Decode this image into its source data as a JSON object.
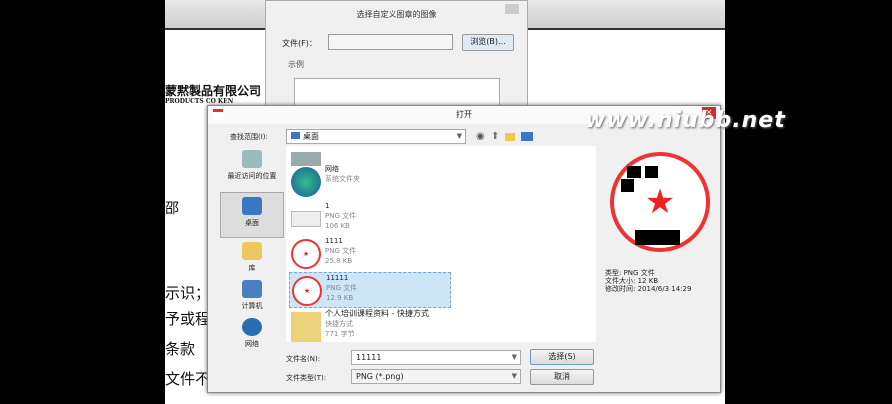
{
  "document": {
    "company_cn": "蒙黙製品有限公司",
    "company_en": "PRODUCTS CO KEN",
    "fragments": [
      "邵",
      "示识；",
      "予或程",
      "条款",
      "文件不"
    ]
  },
  "back_dialog": {
    "title": "选择自定义图章的图像",
    "file_label": "文件(F)：",
    "file_value": "",
    "browse_label": "浏览(B)...",
    "preview_label": "示例"
  },
  "open_dialog": {
    "title": "打开",
    "close": "✕",
    "look_in_label": "查找范围(I):",
    "look_in_value": "桌面",
    "sidebar": [
      {
        "label": "最近访问的位置"
      },
      {
        "label": "桌面"
      },
      {
        "label": "库"
      },
      {
        "label": "计算机"
      },
      {
        "label": "网络"
      }
    ],
    "files": [
      {
        "name": "",
        "type": "系统文件夹",
        "size": ""
      },
      {
        "name": "网络",
        "type": "系统文件夹",
        "size": ""
      },
      {
        "name": "1",
        "type": "PNG 文件",
        "size": "106 KB"
      },
      {
        "name": "1111",
        "type": "PNG 文件",
        "size": "25.8 KB"
      },
      {
        "name": "11111",
        "type": "PNG 文件",
        "size": "12.9 KB"
      },
      {
        "name": "个人培训课程资料 - 快捷方式",
        "type": "快捷方式",
        "size": "771 字节"
      }
    ],
    "preview_info": {
      "type": "类型: PNG 文件",
      "size": "文件大小: 12 KB",
      "modified": "修改时间: 2014/6/3 14:29"
    },
    "filename_label": "文件名(N):",
    "filename_value": "11111",
    "filetype_label": "文件类型(T):",
    "filetype_value": "PNG (*.png)",
    "select_label": "选择(S)",
    "cancel_label": "取消"
  },
  "watermark": "www.niubb.net"
}
